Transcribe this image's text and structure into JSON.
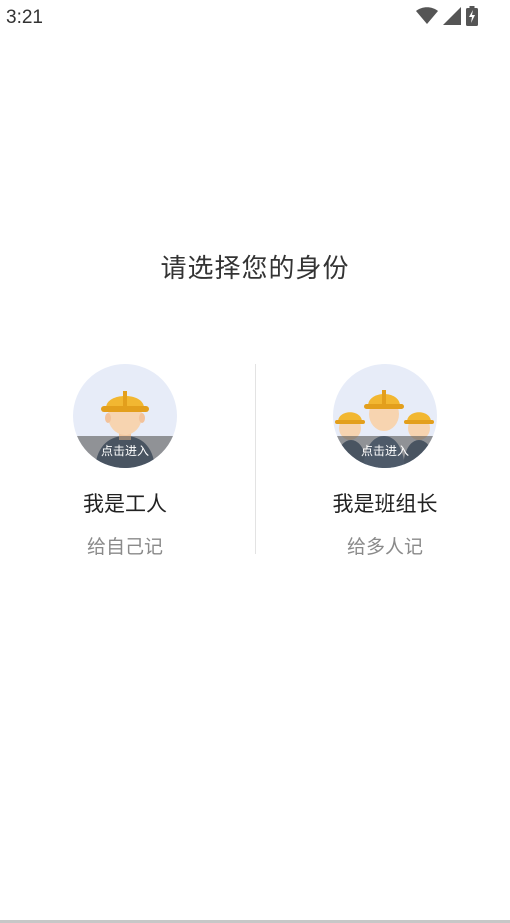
{
  "status_bar": {
    "time": "3:21",
    "icons": [
      "wifi-icon",
      "cell-signal-icon",
      "battery-charging-icon"
    ]
  },
  "title": "请选择您的身份",
  "roles": [
    {
      "name": "我是工人",
      "description": "给自己记",
      "overlay_label": "点击进入",
      "avatar": "single-worker-helmet-illustration"
    },
    {
      "name": "我是班组长",
      "description": "给多人记",
      "overlay_label": "点击进入",
      "avatar": "team-workers-helmet-illustration"
    }
  ],
  "colors": {
    "avatar_bg": "#e7ecf8",
    "helmet": "#f2b731",
    "overlay": "#5a5a5a",
    "secondary_text": "#8a8a8a"
  }
}
